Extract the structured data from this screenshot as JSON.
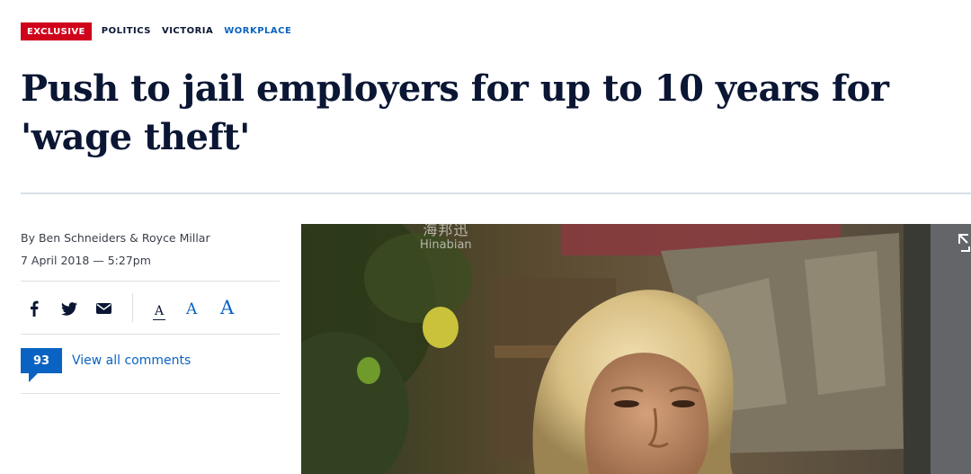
{
  "tags": {
    "exclusive": "EXCLUSIVE",
    "items": [
      "POLITICS",
      "VICTORIA",
      "WORKPLACE"
    ]
  },
  "headline": "Push to jail employers for up to 10 years for 'wage theft'",
  "byline": {
    "authors": "By Ben Schneiders & Royce Millar",
    "date": "7 April 2018 — 5:27pm"
  },
  "share": {
    "icons": [
      "facebook-icon",
      "twitter-icon",
      "email-icon"
    ],
    "font_size_labels": [
      "A",
      "A",
      "A"
    ]
  },
  "comments": {
    "count": "93",
    "label": "View all comments"
  },
  "photo": {
    "watermark_cn": "海邦迅",
    "watermark_en": "Hinabian"
  },
  "colors": {
    "exclusive_bg": "#d0021b",
    "link_blue": "#0a63c2",
    "headline": "#0a1633"
  }
}
